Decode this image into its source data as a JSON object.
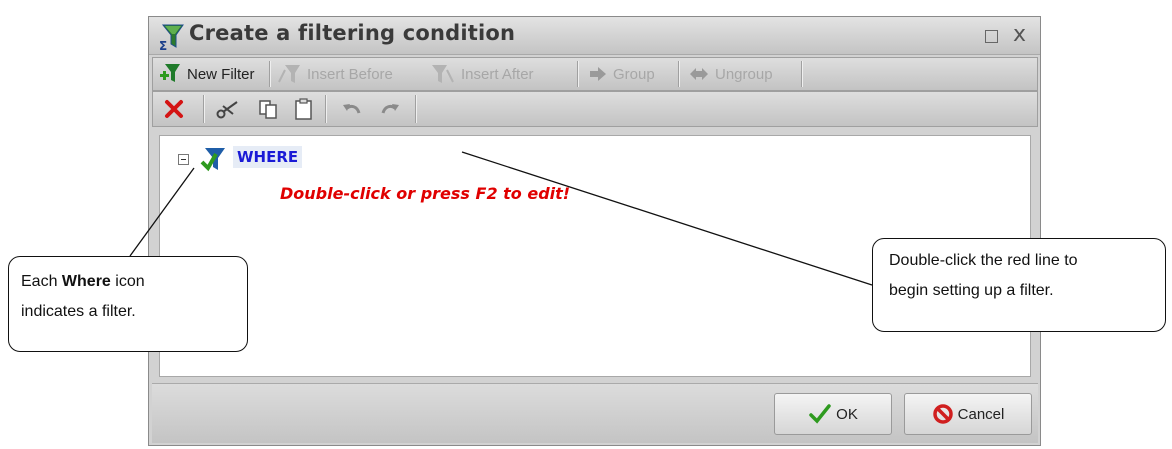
{
  "dialog": {
    "title": "Create a filtering condition",
    "maximize_glyph": "☐",
    "close_glyph": "x"
  },
  "toolbar_main": {
    "new_filter": "New Filter",
    "insert_before": "Insert Before",
    "insert_after": "Insert After",
    "group": "Group",
    "ungroup": "Ungroup"
  },
  "toolbar_edit": {
    "icons": [
      "delete-icon",
      "cut-icon",
      "copy-icon",
      "paste-icon",
      "undo-icon",
      "redo-icon"
    ]
  },
  "tree": {
    "toggle": "collapse",
    "where_label": "WHERE",
    "edit_hint": "Double-click or press F2 to edit!"
  },
  "footer": {
    "ok": "OK",
    "cancel": "Cancel"
  },
  "callouts": {
    "left_prefix": "Each ",
    "left_bold": "Where",
    "left_suffix": " icon",
    "left_line2": "indicates a filter.",
    "right_line1": "Double-click the red line to",
    "right_line2": "begin setting up a filter."
  },
  "colors": {
    "where_blue": "#1a1ad6",
    "hint_red": "#e00000",
    "ok_check": "#2e9a1f",
    "cancel_red": "#d01f1f"
  }
}
